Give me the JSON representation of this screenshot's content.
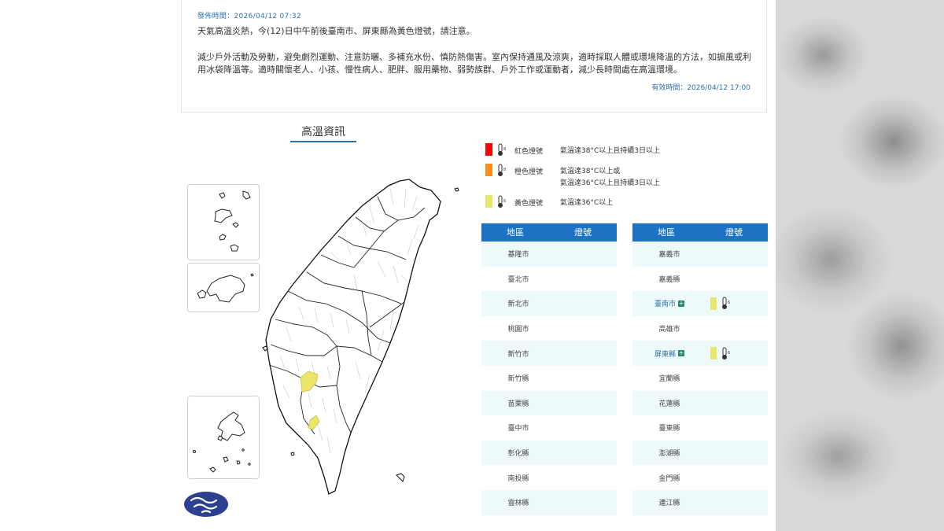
{
  "notice": {
    "issue_time": "發佈時間：2026/04/12 07:32",
    "headline": "天氣高溫炎熱，今(12)日中午前後臺南市、屏東縣為黃色燈號，請注意。",
    "advice": "減少戶外活動及勞動，避免劇烈運動、注意防曬、多補充水份、慎防熱傷害。室內保持通風及涼爽，適時採取人體或環境降溫的方法，如搧風或利用冰袋降溫等。適時關懷老人、小孩、慢性病人、肥胖、服用藥物、弱勢族群、戶外工作或運動者，減少長時間處在高溫環境。",
    "valid_time": "有效時間：2026/04/12 17:00"
  },
  "map": {
    "title": "高溫資訊"
  },
  "legend": [
    {
      "name": "紅色燈號",
      "desc": "氣溫達38°C以上且持續3日以上",
      "color": "#ff0000",
      "icon": "thermometer-icon"
    },
    {
      "name": "橙色燈號",
      "desc": "氣溫達38°C以上或",
      "desc2": "氣溫達36°C以上且持續3日以上",
      "color": "#ff8c1a",
      "icon": "thermometer-icon"
    },
    {
      "name": "黃色燈號",
      "desc": "氣溫達36°C以上",
      "color": "#e9e66a",
      "icon": "thermometer-icon"
    }
  ],
  "table": {
    "col_region": "地區",
    "col_signal": "燈號",
    "left": [
      {
        "name": "基隆市"
      },
      {
        "name": "臺北市"
      },
      {
        "name": "新北市"
      },
      {
        "name": "桃園市"
      },
      {
        "name": "新竹市"
      },
      {
        "name": "新竹縣"
      },
      {
        "name": "苗栗縣"
      },
      {
        "name": "臺中市"
      },
      {
        "name": "彰化縣"
      },
      {
        "name": "南投縣"
      },
      {
        "name": "雲林縣"
      }
    ],
    "right": [
      {
        "name": "嘉義市"
      },
      {
        "name": "嘉義縣"
      },
      {
        "name": "臺南市",
        "signal": "yellow"
      },
      {
        "name": "高雄市"
      },
      {
        "name": "屏東縣",
        "signal": "yellow"
      },
      {
        "name": "宜蘭縣"
      },
      {
        "name": "花蓮縣"
      },
      {
        "name": "臺東縣"
      },
      {
        "name": "澎湖縣"
      },
      {
        "name": "金門縣"
      },
      {
        "name": "連江縣"
      }
    ]
  },
  "colors": {
    "accent": "#1d72c4",
    "yellow_signal": "#e9e66a",
    "link": "#2f6fb0"
  }
}
